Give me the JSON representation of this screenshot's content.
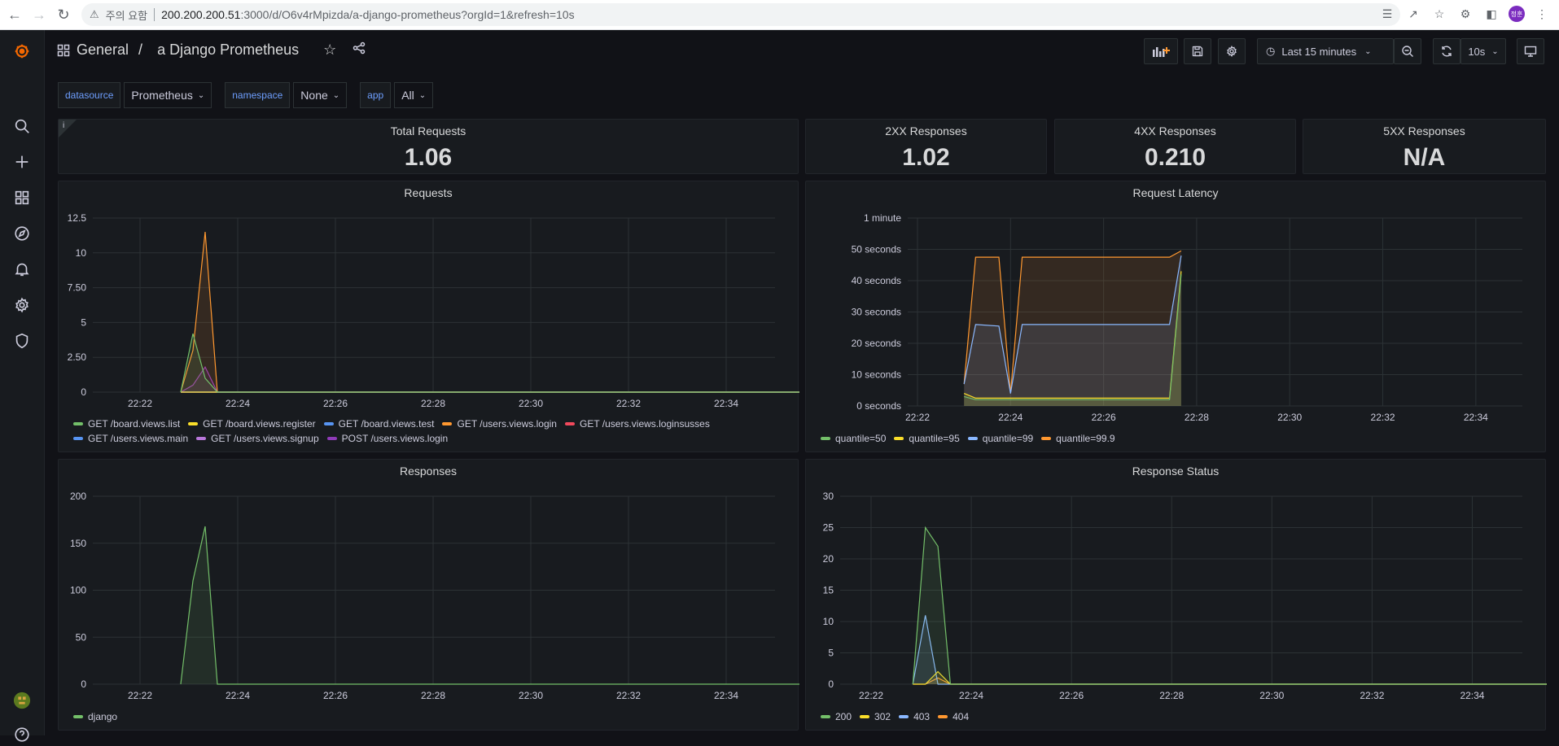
{
  "browser": {
    "security_label": "주의 요함",
    "url_host": "200.200.200.51",
    "url_path": ":3000/d/O6v4rMpizda/a-django-prometheus?orgId=1&refresh=10s",
    "profile_initials": "정훈"
  },
  "topnav": {
    "folder": "General",
    "separator": "/",
    "title": "a Django Prometheus",
    "time_range": "Last 15 minutes",
    "refresh_interval": "10s"
  },
  "variables": [
    {
      "label": "datasource",
      "value": "Prometheus"
    },
    {
      "label": "namespace",
      "value": "None"
    },
    {
      "label": "app",
      "value": "All"
    }
  ],
  "stats": [
    {
      "title": "Total Requests",
      "value": "1.06"
    },
    {
      "title": "2XX Responses",
      "value": "1.02"
    },
    {
      "title": "4XX Responses",
      "value": "0.210"
    },
    {
      "title": "5XX Responses",
      "value": "N/A"
    }
  ],
  "x_ticks": [
    "22:22",
    "22:24",
    "22:26",
    "22:28",
    "22:30",
    "22:32",
    "22:34"
  ],
  "chart_data": [
    {
      "type": "line",
      "title": "Requests",
      "x_ticks": [
        "22:22",
        "22:24",
        "22:26",
        "22:28",
        "22:30",
        "22:32",
        "22:34"
      ],
      "y_ticks": [
        "0",
        "2.50",
        "5",
        "7.50",
        "10",
        "12.5"
      ],
      "ylim": [
        0,
        12.5
      ],
      "x": [
        "22:22:50",
        "22:23:05",
        "22:23:20",
        "22:23:35",
        "22:23:50",
        "22:35:30"
      ],
      "series": [
        {
          "name": "GET /board.views.list",
          "color": "#73bf69",
          "values": [
            0,
            4.2,
            1.0,
            0,
            0,
            0
          ]
        },
        {
          "name": "GET /board.views.register",
          "color": "#fade2a",
          "values": [
            0,
            0,
            0,
            0,
            0,
            0
          ]
        },
        {
          "name": "GET /board.views.test",
          "color": "#5794f2",
          "values": [
            0,
            0,
            0,
            0,
            0,
            0
          ]
        },
        {
          "name": "GET /users.views.login",
          "color": "#ff9830",
          "values": [
            0,
            3.0,
            11.5,
            0,
            0,
            0
          ]
        },
        {
          "name": "GET /users.views.loginsusses",
          "color": "#f2495c",
          "values": [
            0,
            0,
            0,
            0,
            0,
            0
          ]
        },
        {
          "name": "GET /users.views.main",
          "color": "#5794f2",
          "values": [
            0,
            0,
            0,
            0,
            0,
            0
          ]
        },
        {
          "name": "GET /users.views.signup",
          "color": "#b877d9",
          "values": [
            0,
            0,
            0,
            0,
            0,
            0
          ]
        },
        {
          "name": "POST /users.views.login",
          "color": "#8f3bb8",
          "values": [
            0,
            0.5,
            1.8,
            0,
            0,
            0
          ]
        }
      ]
    },
    {
      "type": "area",
      "title": "Request Latency",
      "x_ticks": [
        "22:22",
        "22:24",
        "22:26",
        "22:28",
        "22:30",
        "22:32",
        "22:34"
      ],
      "y_ticks": [
        "0 seconds",
        "10 seconds",
        "20 seconds",
        "30 seconds",
        "40 seconds",
        "50 seconds",
        "1 minute"
      ],
      "ylim": [
        0,
        60
      ],
      "x": [
        "22:23:00",
        "22:23:15",
        "22:23:45",
        "22:24:00",
        "22:24:15",
        "22:27:25",
        "22:27:40"
      ],
      "series": [
        {
          "name": "quantile=50",
          "color": "#73bf69",
          "values": [
            3,
            2,
            2,
            2,
            2,
            2,
            42
          ]
        },
        {
          "name": "quantile=95",
          "color": "#fade2a",
          "values": [
            4,
            2.5,
            2.5,
            2.5,
            2.5,
            2.5,
            43
          ]
        },
        {
          "name": "quantile=99",
          "color": "#8ab8ff",
          "values": [
            7,
            26,
            25.5,
            4,
            26,
            26,
            48
          ]
        },
        {
          "name": "quantile=99.9",
          "color": "#ff9830",
          "values": [
            7,
            47.5,
            47.5,
            4,
            47.5,
            47.5,
            49.5
          ]
        }
      ]
    },
    {
      "type": "line",
      "title": "Responses",
      "x_ticks": [
        "22:22",
        "22:24",
        "22:26",
        "22:28",
        "22:30",
        "22:32",
        "22:34"
      ],
      "y_ticks": [
        "0",
        "50",
        "100",
        "150",
        "200"
      ],
      "ylim": [
        0,
        200
      ],
      "x": [
        "22:22:50",
        "22:23:05",
        "22:23:20",
        "22:23:35",
        "22:35:30"
      ],
      "series": [
        {
          "name": "django",
          "color": "#73bf69",
          "values": [
            0,
            110,
            168,
            0,
            0
          ]
        }
      ]
    },
    {
      "type": "line",
      "title": "Response Status",
      "x_ticks": [
        "22:22",
        "22:24",
        "22:26",
        "22:28",
        "22:30",
        "22:32",
        "22:34"
      ],
      "y_ticks": [
        "0",
        "5",
        "10",
        "15",
        "20",
        "25",
        "30"
      ],
      "ylim": [
        0,
        30
      ],
      "x": [
        "22:22:50",
        "22:23:05",
        "22:23:20",
        "22:23:35",
        "22:35:30"
      ],
      "series": [
        {
          "name": "200",
          "color": "#73bf69",
          "values": [
            0,
            25,
            22,
            0,
            0
          ]
        },
        {
          "name": "302",
          "color": "#fade2a",
          "values": [
            0,
            0,
            2,
            0,
            0
          ]
        },
        {
          "name": "403",
          "color": "#8ab8ff",
          "values": [
            0,
            11,
            0,
            0,
            0
          ]
        },
        {
          "name": "404",
          "color": "#ff9830",
          "values": [
            0,
            0,
            1,
            0,
            0
          ]
        }
      ]
    }
  ]
}
